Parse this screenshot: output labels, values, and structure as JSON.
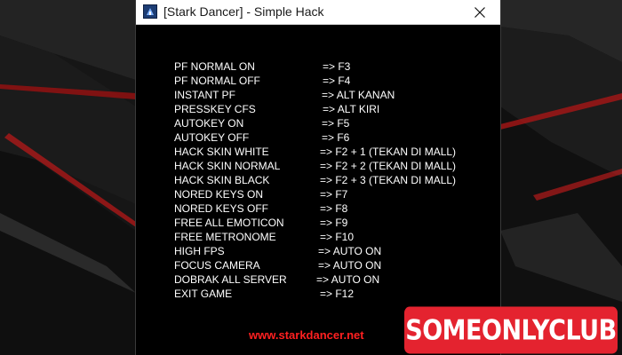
{
  "window": {
    "title": "[Stark Dancer] - Simple Hack",
    "close_icon": "close-icon",
    "app_icon": "app-icon"
  },
  "hotkeys": [
    {
      "label": "PF NORMAL ON",
      "key": "=> F3"
    },
    {
      "label": "PF NORMAL OFF",
      "key": "=> F4"
    },
    {
      "label": "INSTANT PF",
      "key": "=> ALT KANAN"
    },
    {
      "label": "PRESSKEY CFS",
      "key": "=> ALT KIRI"
    },
    {
      "label": "AUTOKEY ON",
      "key": "=> F5"
    },
    {
      "label": "AUTOKEY OFF",
      "key": "=> F6"
    },
    {
      "label": "HACK SKIN WHITE",
      "key": "=> F2 + 1 (TEKAN DI MALL)"
    },
    {
      "label": "HACK SKIN NORMAL",
      "key": "=> F2 + 2 (TEKAN DI MALL)"
    },
    {
      "label": "HACK SKIN BLACK",
      "key": "=> F2 + 3 (TEKAN DI MALL)"
    },
    {
      "label": "NORED KEYS ON",
      "key": "=> F7"
    },
    {
      "label": "NORED KEYS OFF",
      "key": "=> F8"
    },
    {
      "label": "FREE ALL EMOTICON",
      "key": "=> F9"
    },
    {
      "label": "FREE METRONOME",
      "key": "=> F10"
    },
    {
      "label": "HIGH FPS",
      "key": "=> AUTO ON"
    },
    {
      "label": "FOCUS CAMERA",
      "key": "=> AUTO ON"
    },
    {
      "label": "DOBRAK ALL SERVER",
      "key": "=> AUTO ON"
    },
    {
      "label": "EXIT GAME",
      "key": "=> F12"
    }
  ],
  "website": "www.starkdancer.net",
  "watermark": "SOMEONLYCLUB",
  "colors": {
    "window_bg": "#000000",
    "text": "#ffffff",
    "website": "#ff2020",
    "badge_bg": "#e4232f"
  }
}
